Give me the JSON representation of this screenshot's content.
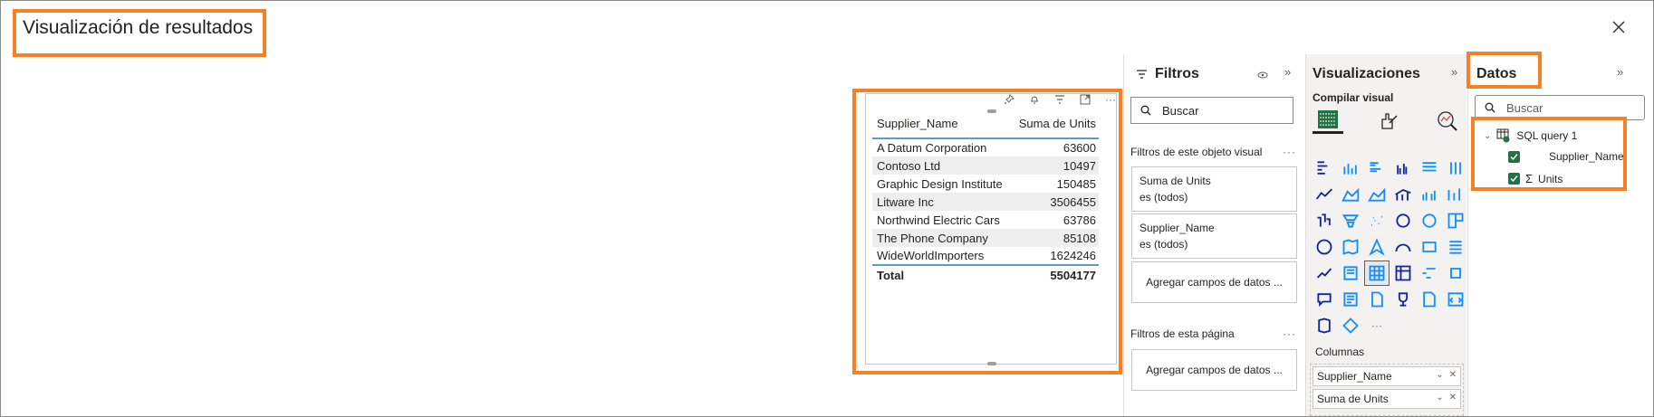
{
  "dialog": {
    "title": "Visualización de resultados",
    "close_label": "✕"
  },
  "table_visual": {
    "headers": [
      "Supplier_Name",
      "Suma de Units"
    ],
    "rows": [
      {
        "name": "A Datum Corporation",
        "value": "63600"
      },
      {
        "name": "Contoso Ltd",
        "value": "10497"
      },
      {
        "name": "Graphic Design Institute",
        "value": "150485"
      },
      {
        "name": "Litware Inc",
        "value": "3506455"
      },
      {
        "name": "Northwind Electric Cars",
        "value": "63786"
      },
      {
        "name": "The Phone Company",
        "value": "85108"
      },
      {
        "name": "WideWorldImporters",
        "value": "1624246"
      }
    ],
    "total_label": "Total",
    "total_value": "5504177",
    "toolbar_icons": [
      "pin-icon",
      "bell-icon",
      "filter-icon",
      "focus-mode-icon",
      "more-options-icon"
    ]
  },
  "filters_panel": {
    "title": "Filtros",
    "collapse_label": "»",
    "search_placeholder": "Buscar",
    "visual_filters_label": "Filtros de este objeto visual",
    "visual_filters": [
      {
        "field": "Suma de Units",
        "state": "es (todos)"
      },
      {
        "field": "Supplier_Name",
        "state": "es (todos)"
      }
    ],
    "add_fields_label": "Agregar campos de datos ...",
    "page_filters_label": "Filtros de esta página",
    "page_add_fields_label": "Agregar campos de datos ...",
    "more_label": "···"
  },
  "visualizations_panel": {
    "title": "Visualizaciones",
    "collapse_label": "»",
    "build_label": "Compilar visual",
    "columns_label": "Columnas",
    "column_fields": [
      "Supplier_Name",
      "Suma de Units"
    ],
    "more_visuals_label": "···",
    "accent_color": "#217346"
  },
  "data_panel": {
    "title": "Datos",
    "collapse_label": "»",
    "search_placeholder": "Buscar",
    "table_name": "SQL query 1",
    "fields": [
      "Supplier_Name",
      "Units"
    ]
  },
  "colors": {
    "highlight": "#f58025",
    "table_rule": "#5b9bd5",
    "row_alt": "#eeeeee",
    "check": "#217346"
  }
}
